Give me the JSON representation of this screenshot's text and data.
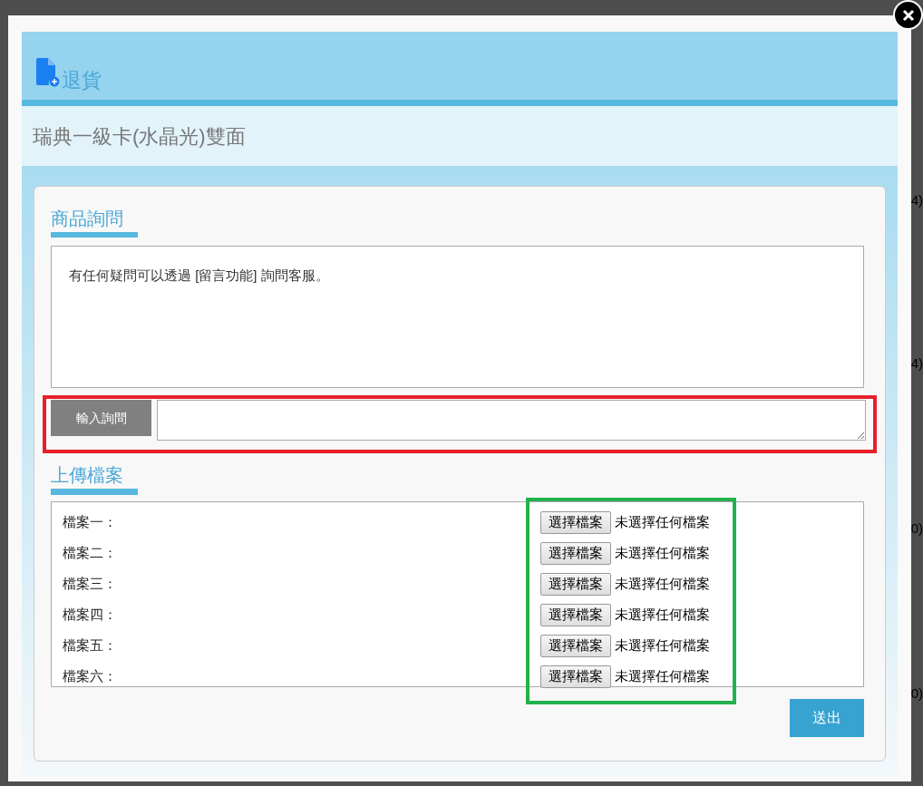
{
  "background_fragments": [
    {
      "text": "4)"
    },
    {
      "text": "4)"
    },
    {
      "text": "0)"
    },
    {
      "text": "0)"
    }
  ],
  "dialog": {
    "title": "退貨",
    "subtitle": "瑞典一級卡(水晶光)雙面",
    "inquiry": {
      "heading": "商品詢問",
      "message": "有任何疑問可以透過 [留言功能] 詢問客服。",
      "input_button": "輸入詢問"
    },
    "upload": {
      "heading": "上傳檔案",
      "files": [
        {
          "label": "檔案一：",
          "button": "選擇檔案",
          "status": "未選擇任何檔案"
        },
        {
          "label": "檔案二：",
          "button": "選擇檔案",
          "status": "未選擇任何檔案"
        },
        {
          "label": "檔案三：",
          "button": "選擇檔案",
          "status": "未選擇任何檔案"
        },
        {
          "label": "檔案四：",
          "button": "選擇檔案",
          "status": "未選擇任何檔案"
        },
        {
          "label": "檔案五：",
          "button": "選擇檔案",
          "status": "未選擇任何檔案"
        },
        {
          "label": "檔案六：",
          "button": "選擇檔案",
          "status": "未選擇任何檔案"
        }
      ]
    },
    "submit_button": "送出"
  },
  "annotations": [
    {
      "color": "#e8202a"
    },
    {
      "color": "#22b14c"
    }
  ]
}
